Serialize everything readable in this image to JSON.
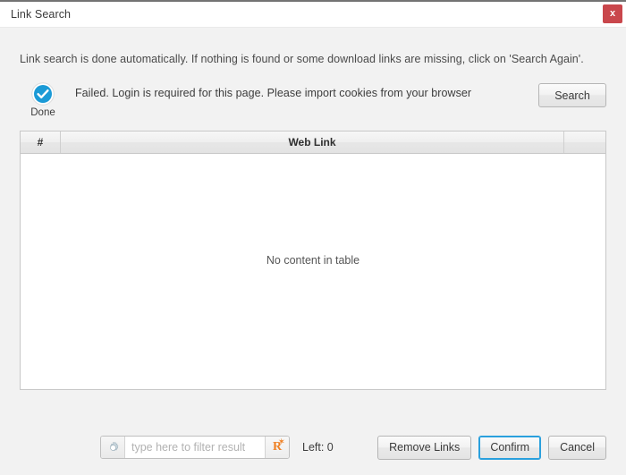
{
  "window": {
    "title": "Link Search",
    "close_label": "x",
    "close_icon": "close-icon"
  },
  "hint": {
    "text": "Link search is done automatically. If nothing is found or some download links are missing, click on 'Search Again'."
  },
  "status": {
    "icon": "check-circle-icon",
    "icon_color": "#1b9ad6",
    "label": "Done",
    "message": "Failed. Login is required for this page. Please import cookies from your browser"
  },
  "actions": {
    "search_label": "Search"
  },
  "table": {
    "columns": [
      {
        "key": "index",
        "label": "#"
      },
      {
        "key": "weblink",
        "label": "Web Link"
      },
      {
        "key": "extra",
        "label": ""
      }
    ],
    "rows": [],
    "empty_text": "No content in table"
  },
  "footer": {
    "filter": {
      "gear_icon": "gear-icon",
      "value": "",
      "placeholder": "type here to filter result",
      "regex_icon": "regex-r-icon",
      "regex_letter": "R",
      "regex_star": "✶"
    },
    "left_count_label": "Left: 0",
    "remove_links_label": "Remove Links",
    "confirm_label": "Confirm",
    "cancel_label": "Cancel",
    "focus_color": "#2aa0dd"
  }
}
